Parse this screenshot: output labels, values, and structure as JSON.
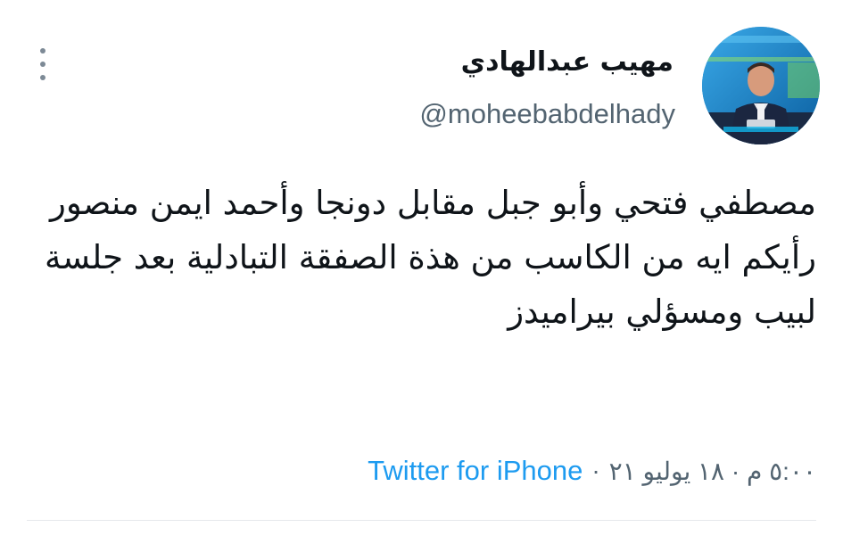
{
  "tweet": {
    "author": {
      "display_name": "مهيب عبدالهادي",
      "handle": "@moheebabdelhady",
      "avatar": "avatar-photo"
    },
    "text": "مصطفي فتحي وأبو جبل مقابل دونجا وأحمد ايمن منصور رأيكم ايه من الكاسب من هذة الصفقة التبادلية بعد جلسة لبيب ومسؤلي بيراميدز",
    "timestamp": "٥:٠٠ م · ١٨ يوليو ٢١",
    "separator": "·",
    "source": "Twitter for iPhone",
    "more_icon": "vertical-ellipsis-icon"
  },
  "colors": {
    "text_primary": "#0f1419",
    "text_secondary": "#536471",
    "link": "#1d9bf0",
    "divider": "#e6e9ec",
    "avatar_background": "#1e86c4"
  }
}
